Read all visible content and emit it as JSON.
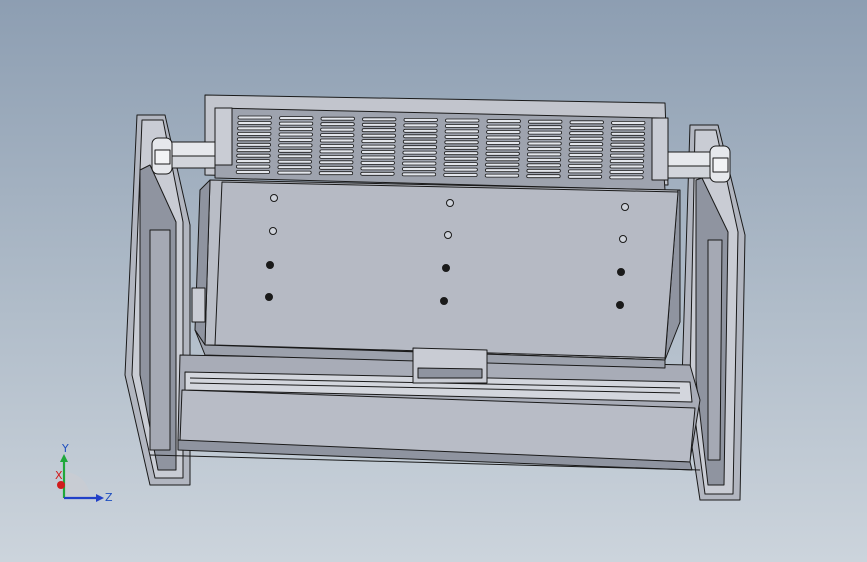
{
  "viewport": {
    "background_top": "#8d9eb2",
    "background_bottom": "#ccd4dc"
  },
  "model": {
    "part_color": "#b9bdc6",
    "edge_color": "#1a1a1a",
    "face_dark": "#8f94a0",
    "face_mid": "#a8acb7",
    "face_light": "#cdd0d8"
  },
  "triad": {
    "y_label": "Y",
    "z_label": "Z",
    "x_label": "X",
    "colors": {
      "x": "#d01c1c",
      "y": "#1fa83a",
      "z": "#2140c8"
    }
  }
}
